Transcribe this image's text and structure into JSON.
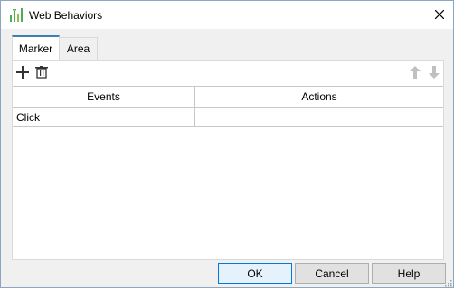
{
  "window": {
    "title": "Web Behaviors",
    "close_label": "×"
  },
  "tabs": [
    {
      "label": "Marker",
      "selected": true
    },
    {
      "label": "Area",
      "selected": false
    }
  ],
  "toolbar": {
    "add_icon": "plus-icon",
    "delete_icon": "trash-icon",
    "move_up_icon": "arrow-up-icon",
    "move_down_icon": "arrow-down-icon"
  },
  "table": {
    "columns": [
      "Events",
      "Actions"
    ],
    "rows": [
      [
        "Click",
        ""
      ]
    ]
  },
  "buttons": {
    "ok": "OK",
    "cancel": "Cancel",
    "help": "Help"
  },
  "colors": {
    "accent": "#3c7fb1",
    "icon_green": "#4caf50",
    "disabled": "#c0c0c0"
  }
}
